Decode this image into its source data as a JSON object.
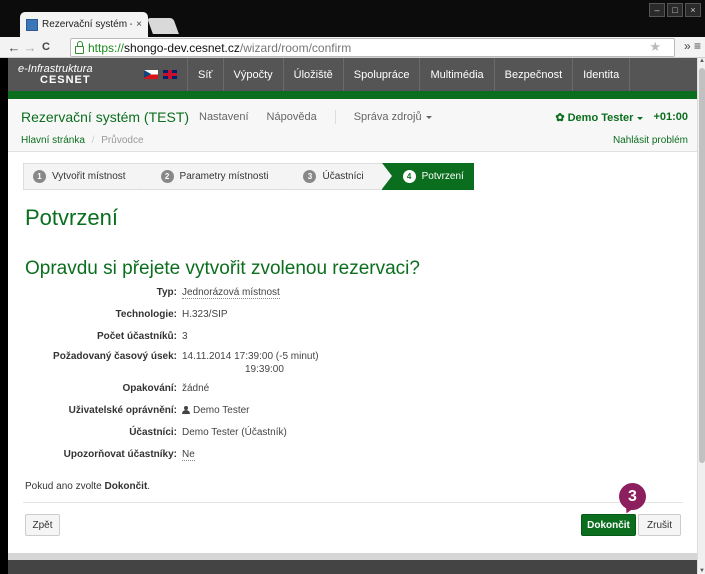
{
  "browser": {
    "tab_title": "Rezervační systém - Prův",
    "tab_close": "×",
    "url_scheme": "https://",
    "url_host": "shongo-dev.cesnet.cz",
    "url_path": "/wizard/room/confirm",
    "back": "←",
    "forward": "→",
    "reload": "C",
    "star": "★",
    "extra": "» ≡",
    "window_controls": [
      "–",
      "□",
      "×"
    ]
  },
  "topbar": {
    "logo_top": "e-Infrastruktura",
    "logo_bottom": "CESNET",
    "items": [
      "Síť",
      "Výpočty",
      "Úložiště",
      "Spolupráce",
      "Multimédia",
      "Bezpečnost",
      "Identita"
    ]
  },
  "appnav": {
    "brand": "Rezervační systém (TEST)",
    "menu": [
      "Nastavení",
      "Nápověda"
    ],
    "resources": "Správa zdrojů",
    "user": "✿ Demo Tester",
    "timezone": "+01:00",
    "breadcrumb_home": "Hlavní stránka",
    "breadcrumb_sep": "/",
    "breadcrumb_current": "Průvodce",
    "report": "Nahlásit problém"
  },
  "wizard": {
    "steps": [
      {
        "num": "1",
        "label": "Vytvořit místnost"
      },
      {
        "num": "2",
        "label": "Parametry místnosti"
      },
      {
        "num": "3",
        "label": "Účastníci"
      },
      {
        "num": "4",
        "label": "Potvrzení"
      }
    ],
    "active_step": 4
  },
  "page": {
    "title": "Potvrzení",
    "question": "Opravdu si přejete vytvořit zvolenou rezervaci?"
  },
  "details": {
    "type_label": "Typ:",
    "type_value": "Jednorázová místnost",
    "tech_label": "Technologie:",
    "tech_value": "H.323/SIP",
    "count_label": "Počet účastníků:",
    "count_value": "3",
    "slot_label": "Požadovaný časový úsek:",
    "slot_value": "14.11.2014 17:39:00 (-5 minut)",
    "slot_value_end": "19:39:00",
    "repeat_label": "Opakování:",
    "repeat_value": "žádné",
    "perm_label": "Uživatelské oprávnění:",
    "perm_value": "Demo Tester",
    "participants_label": "Účastníci:",
    "participants_value": "Demo Tester (Účastník)",
    "notify_label": "Upozorňovat účastníky:",
    "notify_value": "Ne"
  },
  "hint": {
    "text": "Pokud ano zvolte ",
    "bold": "Dokončit",
    "end": "."
  },
  "buttons": {
    "back": "Zpět",
    "finish": "Dokončit",
    "cancel": "Zrušit"
  },
  "annotation": {
    "badge": "3",
    "color": "#8c1f5e"
  },
  "colors": {
    "brand_green": "#0b6e1e",
    "topbar_gray": "#555555"
  }
}
